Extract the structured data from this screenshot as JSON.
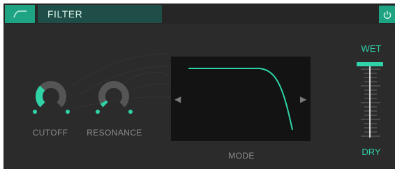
{
  "header": {
    "title": "FILTER",
    "type_icon": "filter-curve-icon",
    "power_icon": "power-icon"
  },
  "knobs": [
    {
      "label": "CUTOFF",
      "value": 0.33
    },
    {
      "label": "RESONANCE",
      "value": 0.06
    }
  ],
  "mode": {
    "label": "MODE",
    "prev_icon": "arrow-left-icon",
    "next_icon": "arrow-right-icon",
    "curve": "lowpass"
  },
  "mix": {
    "top_label": "WET",
    "bottom_label": "DRY",
    "value": 1.0
  },
  "colors": {
    "accent": "#2fd3a7",
    "button": "#1fa483",
    "panel": "#2b2b2b",
    "title_bar": "#1e4e47",
    "display": "#131313"
  }
}
